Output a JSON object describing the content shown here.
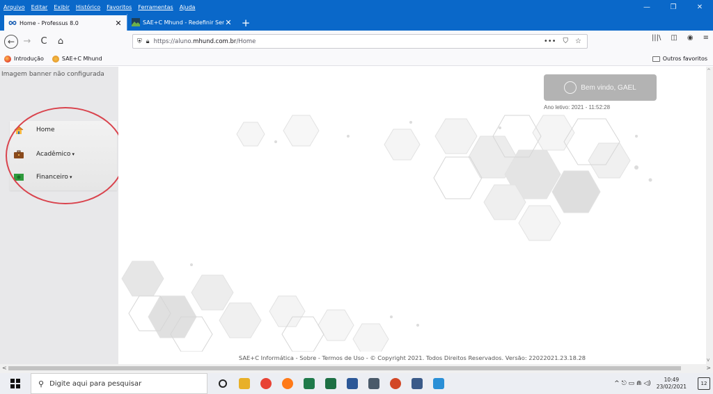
{
  "menubar": {
    "items": [
      "Arquivo",
      "Editar",
      "Exibir",
      "Histórico",
      "Favoritos",
      "Ferramentas",
      "Ajuda"
    ],
    "minimize": "—",
    "restore": "❐",
    "close": "✕"
  },
  "tabs": [
    {
      "title": "Home - Professus 8.0",
      "active": true
    },
    {
      "title": "SAE+C Mhund - Redefinir Senh",
      "active": false
    }
  ],
  "new_tab": "+",
  "tab_close": "✕",
  "nav": {
    "back": "←",
    "forward": "→",
    "reload": "C",
    "home": "⌂",
    "url_prefix": "https://aluno.",
    "url_domain": "mhund.com.br",
    "url_path": "/Home",
    "more": "•••",
    "pocket": "⛉",
    "star": "☆",
    "library": "|||\\",
    "sidebar": "◫",
    "account": "◉",
    "menu": "≡"
  },
  "bookmarks": {
    "items": [
      "Introdução",
      "SAE+C Mhund"
    ],
    "other": "Outros favoritos"
  },
  "page": {
    "banner_text": "Imagem banner não configurada",
    "menu": [
      {
        "label": "Home",
        "caret": ""
      },
      {
        "label": "Acadêmico",
        "caret": "▾"
      },
      {
        "label": "Financeiro",
        "caret": "▾"
      }
    ],
    "welcome": "Bem vindo, GAEL",
    "ano_letivo": "Ano letivo: 2021 - 11:52:28",
    "footer": "SAE+C Informática - Sobre - Termos de Uso - © Copyright 2021. Todos Direitos Reservados. Versão: 22022021.23.18.28"
  },
  "scroll": {
    "up": "^",
    "down": "v",
    "left": "<",
    "right": ">"
  },
  "taskbar": {
    "search_placeholder": "Digite aqui para pesquisar",
    "search_icon": "⚲",
    "time": "10:49",
    "date": "23/02/2021",
    "tray_icons": "^  ⎋  ▭  ⋒  ◁)",
    "notifications": "12",
    "apps": [
      "cortana-icon",
      "file-explorer-icon",
      "chrome-icon",
      "firefox-icon",
      "cr-app-icon",
      "excel-icon",
      "word-icon",
      "calculator-icon",
      "powerpoint-icon",
      "camera-icon",
      "app-icon"
    ],
    "app_colors": [
      "#222222",
      "#e8b028",
      "#e84335",
      "#ff7a18",
      "#1f7a4a",
      "#1d7044",
      "#2b5797",
      "#4a5a6a",
      "#d24726",
      "#3a5a88",
      "#2a8fd6"
    ]
  }
}
